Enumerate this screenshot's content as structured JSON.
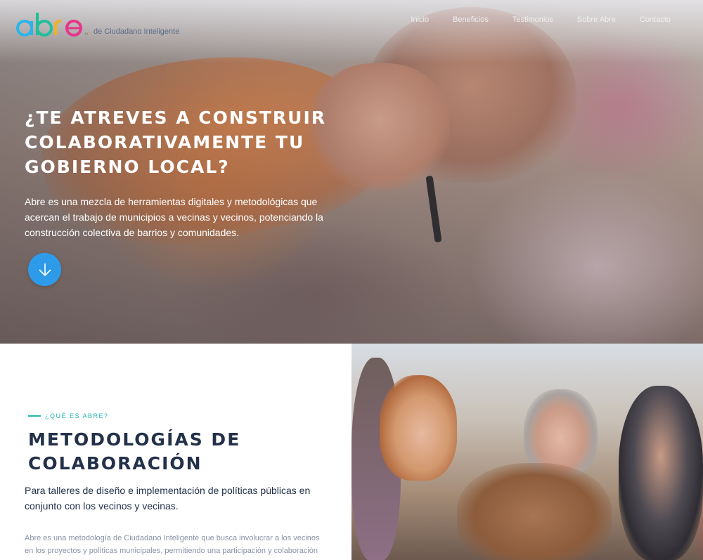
{
  "brand": {
    "logo_text": "abre",
    "tagline": "de Ciudadano Inteligente"
  },
  "nav": {
    "items": [
      {
        "label": "Inicio"
      },
      {
        "label": "Beneficios"
      },
      {
        "label": "Testimonios"
      },
      {
        "label": "Sobre Abre"
      },
      {
        "label": "Contacto"
      }
    ]
  },
  "hero": {
    "title": "¿Te atreves a construir colaborativamente tu gobierno local?",
    "text": "Abre es una mezcla de herramientas digitales y metodológicas que acercan el trabajo de municipios a vecinas y vecinos, potenciando la construcción colectiva de barrios y comunidades.",
    "scroll_icon": "arrow-down-icon",
    "accent_color": "#2e9bea"
  },
  "about": {
    "eyebrow": "¿QUÉ ES ABRE?",
    "title": "METODOLOGÍAS DE COLABORACIÓN",
    "subtitle": "Para talleres de diseño e implementación de políticas públicas en conjunto con los vecinos y vecinas.",
    "body": "Abre es una metodología de Ciudadano Inteligente que busca involucrar a los vecinos en los proyectos y políticas municipales, permitiendo una participación y colaboración más eficiente, con mejores resultados para la comunidad y un mejor",
    "eyebrow_color": "#1fb8a8",
    "title_color": "#233049"
  }
}
